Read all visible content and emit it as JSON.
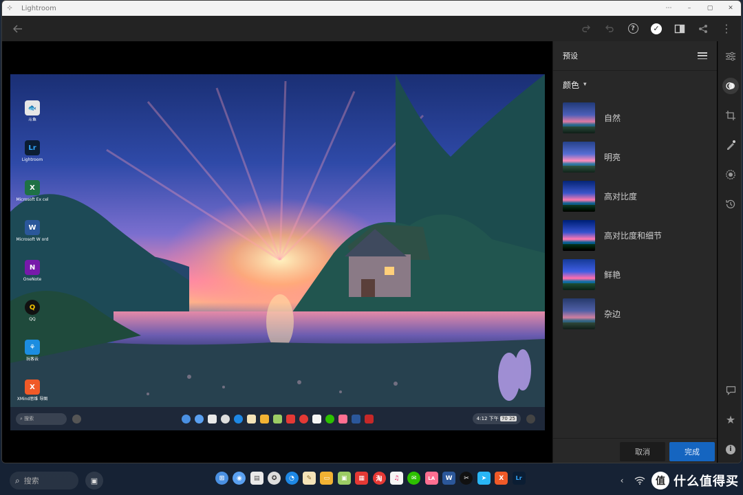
{
  "window": {
    "title": "Lightroom",
    "controls": [
      "⋯",
      "–",
      "▢",
      "✕"
    ]
  },
  "toolbar": {
    "icons": [
      "back-arrow-icon",
      "redo-icon",
      "undo-icon",
      "help-icon",
      "check-icon",
      "compare-icon",
      "share-icon",
      "more-icon"
    ]
  },
  "panel": {
    "title": "预设",
    "category": "颜色",
    "presets": [
      {
        "label": "自然"
      },
      {
        "label": "明亮"
      },
      {
        "label": "高对比度"
      },
      {
        "label": "高对比度和细节"
      },
      {
        "label": "鲜艳"
      },
      {
        "label": "杂边"
      }
    ],
    "cancel_label": "取消",
    "done_label": "完成"
  },
  "rail": {
    "top_icons": [
      "sliders-icon",
      "presets-icon",
      "crop-icon",
      "heal-icon",
      "masking-icon",
      "history-icon"
    ],
    "bottom_icons": [
      "comment-icon",
      "star-icon",
      "info-icon"
    ]
  },
  "photo": {
    "desktop_icons": [
      {
        "label": "斗鱼",
        "glyph": "🐟",
        "color": "#e6e6e6"
      },
      {
        "label": "Lightroom",
        "glyph": "Lr",
        "color": "#0b1d33"
      },
      {
        "label": "Microsoft Ex cel",
        "glyph": "X",
        "color": "#1e7145"
      },
      {
        "label": "Microsoft W ord",
        "glyph": "W",
        "color": "#2b579a"
      },
      {
        "label": "OneNote",
        "glyph": "N",
        "color": "#7719aa"
      },
      {
        "label": "QQ",
        "glyph": "Q",
        "color": "#111111"
      },
      {
        "label": "玩客云",
        "glyph": "⚘",
        "color": "#1c8de0"
      },
      {
        "label": "XMind思维 导图",
        "glyph": "X",
        "color": "#f05a28"
      }
    ],
    "taskbar_search": "搜索",
    "taskbar_time": "4:12 下午",
    "taskbar_badge": "70 25"
  },
  "taskbar": {
    "search_placeholder": "搜索",
    "dock": [
      {
        "name": "launcher-icon",
        "glyph": "⊞",
        "color": "#4a90e2"
      },
      {
        "name": "assistant-icon",
        "glyph": "◉",
        "color": "#5aa0f0"
      },
      {
        "name": "files-icon",
        "glyph": "▤",
        "color": "#e9e9e9"
      },
      {
        "name": "chrome-icon",
        "glyph": "✪",
        "color": "#dddddd"
      },
      {
        "name": "browser-icon",
        "glyph": "◔",
        "color": "#1e88e5"
      },
      {
        "name": "notes-icon",
        "glyph": "✎",
        "color": "#f4e3b8"
      },
      {
        "name": "gallery-icon",
        "glyph": "▭",
        "color": "#f2b233"
      },
      {
        "name": "monitor-icon",
        "glyph": "▣",
        "color": "#9ccc65"
      },
      {
        "name": "calendar-icon",
        "glyph": "▦",
        "color": "#e53935"
      },
      {
        "name": "taobao-icon",
        "glyph": "淘",
        "color": "#e53935"
      },
      {
        "name": "music-icon",
        "glyph": "♫",
        "color": "#f5f5f5"
      },
      {
        "name": "wechat-icon",
        "glyph": "✉",
        "color": "#2dc100"
      },
      {
        "name": "lala-icon",
        "glyph": "LA",
        "color": "#ff6f91"
      },
      {
        "name": "word-icon",
        "glyph": "W",
        "color": "#2b579a"
      },
      {
        "name": "capcut-icon",
        "glyph": "✂",
        "color": "#111111"
      },
      {
        "name": "send-icon",
        "glyph": "➤",
        "color": "#29b6f6"
      },
      {
        "name": "xmind-icon",
        "glyph": "X",
        "color": "#f05a28"
      },
      {
        "name": "lightroom-icon",
        "glyph": "Lr",
        "color": "#0b1d33"
      }
    ],
    "watermark_badge": "值",
    "watermark_text": "什么值得买"
  },
  "colors": {
    "accent": "#1565c0",
    "panel_bg": "#282828"
  }
}
